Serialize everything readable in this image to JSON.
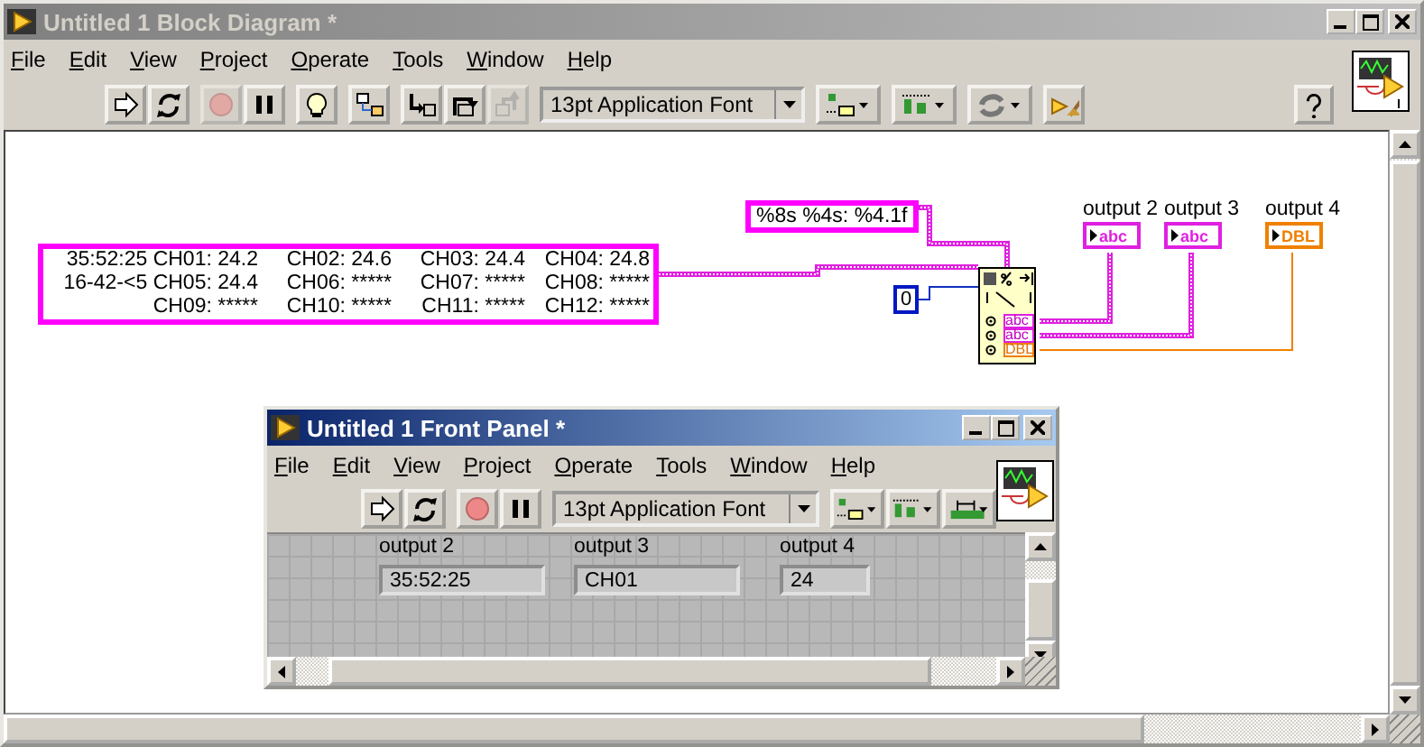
{
  "block_diagram": {
    "title": "Untitled 1 Block Diagram *",
    "menu": [
      "File",
      "Edit",
      "View",
      "Project",
      "Operate",
      "Tools",
      "Window",
      "Help"
    ],
    "toolbar": [
      {
        "kind": "run",
        "disabled": false
      },
      {
        "kind": "run_continuous",
        "disabled": false
      },
      {
        "kind": "abort",
        "disabled": true
      },
      {
        "kind": "pause",
        "disabled": false
      },
      {
        "kind": "highlight",
        "disabled": false
      },
      {
        "kind": "retain",
        "disabled": false
      },
      {
        "kind": "step_into",
        "disabled": false
      },
      {
        "kind": "step_over",
        "disabled": false
      },
      {
        "kind": "step_out",
        "disabled": true
      },
      {
        "kind": "font",
        "label": "13pt Application Font"
      },
      {
        "kind": "align",
        "disabled": false
      },
      {
        "kind": "distribute",
        "disabled": false
      },
      {
        "kind": "reorder",
        "disabled": false
      },
      {
        "kind": "cleanup",
        "disabled": false
      }
    ],
    "nodes": [
      {
        "kind": "string_constant",
        "rows": [
          [
            "35:52:25 CH01: 24.2",
            "CH02: 24.6",
            "CH03: 24.4",
            "CH04: 24.8"
          ],
          [
            "16-42-<5 CH05: 24.4",
            "CH06: *****",
            "CH07: *****",
            "CH08: *****"
          ],
          [
            "CH09: *****",
            "CH10: *****",
            "CH11: *****",
            "CH12: *****"
          ]
        ]
      },
      {
        "kind": "format_constant",
        "text": "%8s %4s: %4.1f"
      },
      {
        "kind": "numeric_constant",
        "text": "0"
      },
      {
        "kind": "scan_from_string",
        "outputs": [
          {
            "kind": "string",
            "text": "abc"
          },
          {
            "kind": "string",
            "text": "abc"
          },
          {
            "kind": "double",
            "text": "DBL"
          }
        ]
      },
      {
        "kind": "indicator",
        "label": "output 2",
        "color": "#e020e0",
        "terminal": "abc"
      },
      {
        "kind": "indicator",
        "label": "output 3",
        "color": "#e020e0",
        "terminal": "abc"
      },
      {
        "kind": "indicator",
        "label": "output 4",
        "color": "#f08000",
        "terminal": "DBL"
      }
    ]
  },
  "front_panel": {
    "title": "Untitled 1 Front Panel *",
    "menu": [
      "File",
      "Edit",
      "View",
      "Project",
      "Operate",
      "Tools",
      "Window",
      "Help"
    ],
    "font": "13pt Application Font",
    "indicators": [
      {
        "label": "output 2",
        "value": "35:52:25"
      },
      {
        "label": "output 3",
        "value": "CH01"
      },
      {
        "label": "output 4",
        "value": "24"
      }
    ]
  }
}
